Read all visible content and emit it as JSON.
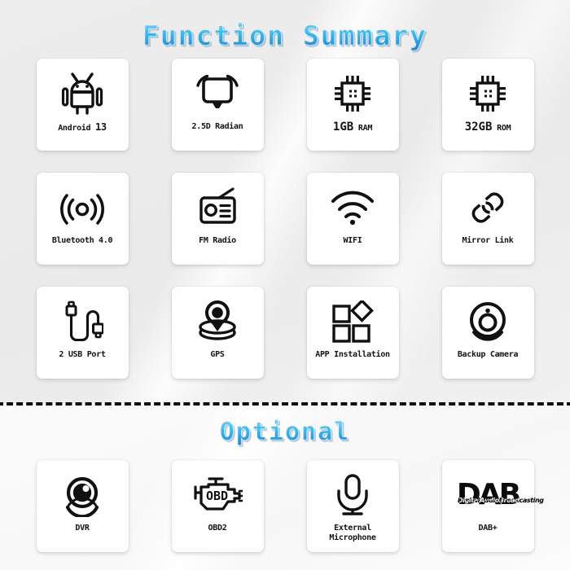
{
  "sections": {
    "main": {
      "title": "Function Summary",
      "title_color": "#35bdf5",
      "items": [
        {
          "icon": "android-robot-icon",
          "label": "Android 13",
          "label_main": "Android ",
          "label_strong": "13",
          "style": "split"
        },
        {
          "icon": "monitor-rotate-icon",
          "label": "2.5D Radian",
          "style": "plain"
        },
        {
          "icon": "cpu-chip-icon",
          "label": "1GB RAM",
          "label_main": "1GB",
          "label_unit": "RAM",
          "style": "big"
        },
        {
          "icon": "cpu-chip-icon",
          "label": "32GB ROM",
          "label_main": "32GB",
          "label_unit": "ROM",
          "style": "big"
        },
        {
          "icon": "signal-waves-icon",
          "label": "Bluetooth 4.0",
          "style": "plain"
        },
        {
          "icon": "fm-radio-icon",
          "label": "FM Radio",
          "style": "plain"
        },
        {
          "icon": "wifi-icon",
          "label": "WIFI",
          "style": "plain"
        },
        {
          "icon": "chain-link-icon",
          "label": "Mirror Link",
          "style": "plain"
        },
        {
          "icon": "usb-cable-icon",
          "label": "2 USB Port",
          "style": "plain"
        },
        {
          "icon": "gps-pin-icon",
          "label": "GPS",
          "style": "plain"
        },
        {
          "icon": "app-grid-icon",
          "label": "APP Installation",
          "style": "plain"
        },
        {
          "icon": "backup-camera-icon",
          "label": "Backup Camera",
          "style": "plain"
        }
      ]
    },
    "optional": {
      "title": "Optional",
      "title_color": "#35bdf5",
      "items": [
        {
          "icon": "dvr-camera-icon",
          "label": "DVR",
          "style": "plain"
        },
        {
          "icon": "obd-engine-icon",
          "label": "OBD2",
          "icon_text": "OBD",
          "style": "plain"
        },
        {
          "icon": "microphone-icon",
          "label": "External\nMicrophone",
          "style": "plain"
        },
        {
          "icon": "dab-logo-icon",
          "label": "DAB+",
          "logo_text": "DAB",
          "logo_subtext": "DigitalAudioBroadcasting",
          "style": "plain"
        }
      ]
    }
  },
  "divider": {
    "style": "dashed",
    "color": "#0d0d0d"
  }
}
